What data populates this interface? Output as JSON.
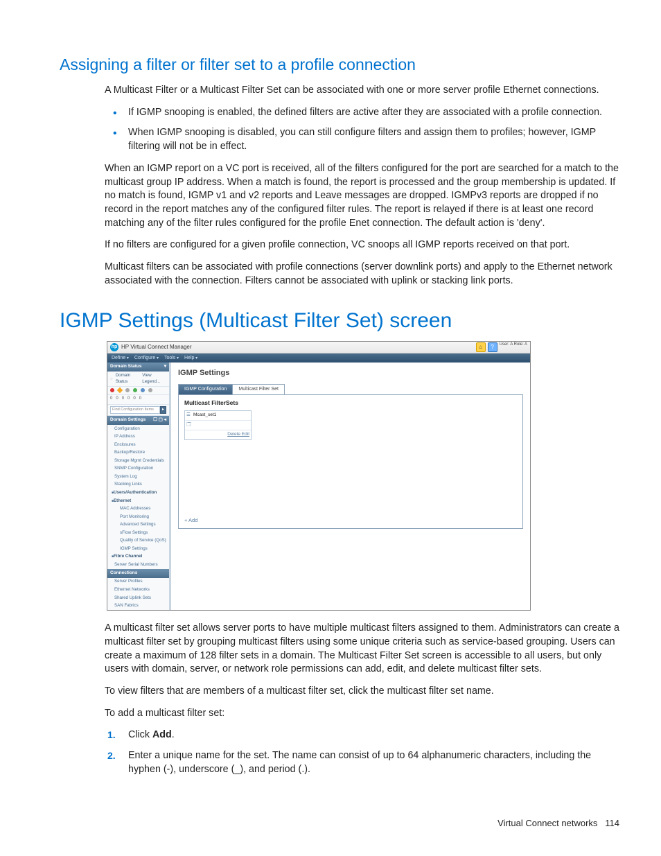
{
  "subsection_title": "Assigning a filter or filter set to a profile connection",
  "p1": "A Multicast Filter or a Multicast Filter Set can be associated with one or more server profile Ethernet connections.",
  "bullets": [
    "If IGMP snooping is enabled, the defined filters are active after they are associated with a profile connection.",
    "When IGMP snooping is disabled, you can still configure filters and assign them to profiles; however, IGMP filtering will not be in effect."
  ],
  "p2": "When an IGMP report on a VC port is received, all of the filters configured for the port are searched for a match to the multicast group IP address. When a match is found, the report is processed and the group membership is updated. If no match is found, IGMP v1 and v2 reports and Leave messages are dropped. IGMPv3 reports are dropped if no record in the report matches any of the configured filter rules. The report is relayed if there is at least one record matching any of the filter rules configured for the profile Enet connection. The default action is 'deny'.",
  "p3": "If no filters are configured for a given profile connection, VC snoops all IGMP reports received on that port.",
  "p4": "Multicast filters can be associated with profile connections (server downlink ports) and apply to the Ethernet network associated with the connection. Filters cannot be associated with uplink or stacking link ports.",
  "section_title": "IGMP Settings (Multicast Filter Set) screen",
  "p5": "A multicast filter set allows server ports to have multiple multicast filters assigned to them. Administrators can create a multicast filter set by grouping multicast filters using some unique criteria such as service-based grouping. Users can create a maximum of 128 filter sets in a domain. The Multicast Filter Set screen is accessible to all users, but only users with domain, server, or network role permissions can add, edit, and delete multicast filter sets.",
  "p6": "To view filters that are members of a multicast filter set, click the multicast filter set name.",
  "p7": "To add a multicast filter set:",
  "steps": {
    "s1a": "Click ",
    "s1b": "Add",
    "s1c": ".",
    "s2": "Enter a unique name for the set. The name can consist of up to 64 alphanumeric characters, including the hyphen (-), underscore (_), and period (.)."
  },
  "footer_section": "Virtual Connect networks",
  "footer_page": "114",
  "app": {
    "title": "HP Virtual Connect Manager",
    "hp": "hp",
    "user_label": "User: A\nRole: A",
    "menus": [
      "Define",
      "Configure",
      "Tools",
      "Help"
    ],
    "sidebar": {
      "status_hd": "Domain Status",
      "status_row": [
        "Domain Status",
        "View Legend..."
      ],
      "counts": [
        "0",
        "0",
        "0",
        "0",
        "0",
        "0"
      ],
      "find_placeholder": "Find Configuration Items",
      "settings_hd": "Domain Settings",
      "items": [
        {
          "l": "Configuration",
          "lvl": 1
        },
        {
          "l": "IP Address",
          "lvl": 1
        },
        {
          "l": "Enclosures",
          "lvl": 1
        },
        {
          "l": "Backup/Restore",
          "lvl": 1
        },
        {
          "l": "Storage Mgmt Credentials",
          "lvl": 1
        },
        {
          "l": "SNMP Configuration",
          "lvl": 1
        },
        {
          "l": "System Log",
          "lvl": 1
        },
        {
          "l": "Stacking Links",
          "lvl": 1
        },
        {
          "l": "Users/Authentication",
          "lvl": 0
        },
        {
          "l": "Ethernet",
          "lvl": 0
        },
        {
          "l": "MAC Addresses",
          "lvl": 2
        },
        {
          "l": "Port Monitoring",
          "lvl": 2
        },
        {
          "l": "Advanced Settings",
          "lvl": 2
        },
        {
          "l": "sFlow Settings",
          "lvl": 2
        },
        {
          "l": "Quality of Service (QoS)",
          "lvl": 2
        },
        {
          "l": "IGMP Settings",
          "lvl": 2
        },
        {
          "l": "Fibre Channel",
          "lvl": 0
        },
        {
          "l": "Server Serial Numbers",
          "lvl": 1
        }
      ],
      "conn_hd": "Connections",
      "conn_items": [
        "Server Profiles",
        "Ethernet Networks",
        "Shared Uplink Sets",
        "SAN Fabrics"
      ]
    },
    "content": {
      "title": "IGMP Settings",
      "tabs": [
        "IGMP Configuration",
        "Multicast Filter Set"
      ],
      "pane_title": "Multicast FilterSets",
      "card_name": "Mcast_set1",
      "card_edit": "Delete Edit",
      "add": "+ Add"
    }
  }
}
